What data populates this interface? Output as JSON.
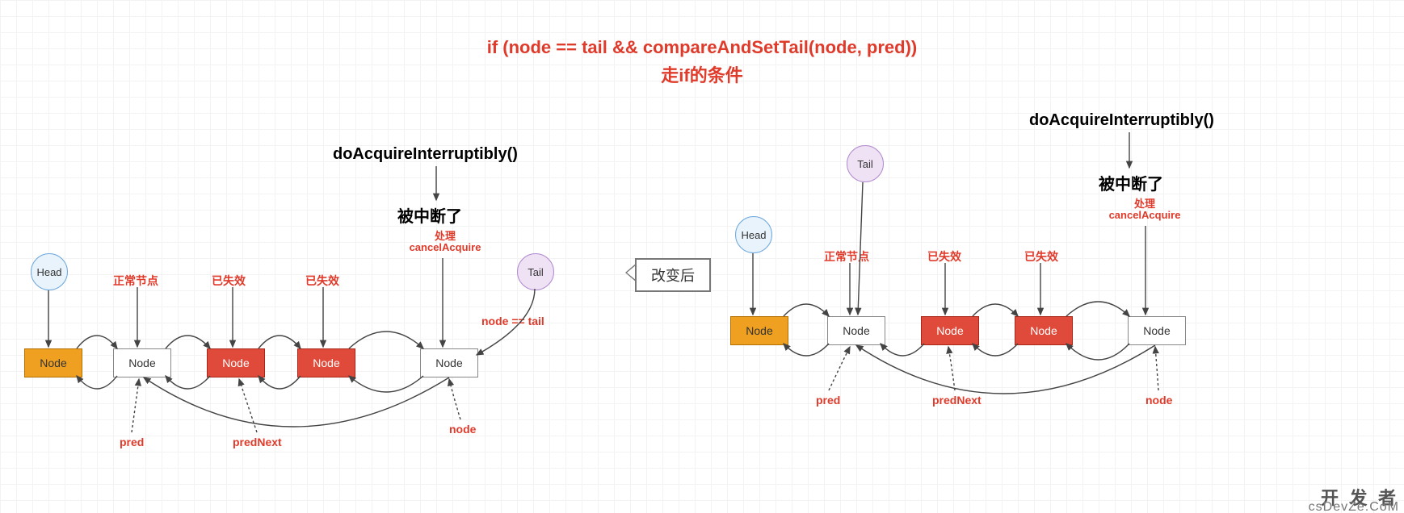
{
  "title": {
    "line1": "if (node == tail && compareAndSetTail(node, pred))",
    "line2": "走if的条件"
  },
  "method_call": "doAcquireInterruptibly()",
  "interrupted": "被中断了",
  "cancel": {
    "line1": "处理",
    "line2": "cancelAcquire"
  },
  "labels": {
    "normal_node": "正常节点",
    "invalidated": "已失效",
    "node_eq_tail": "node == tail",
    "pred": "pred",
    "pred_next": "predNext",
    "node_ptr": "node",
    "head": "Head",
    "tail": "Tail",
    "node": "Node",
    "change_after": "改变后"
  },
  "watermark": {
    "main": "开 发 者",
    "sub": "csDevZe.CoM"
  }
}
